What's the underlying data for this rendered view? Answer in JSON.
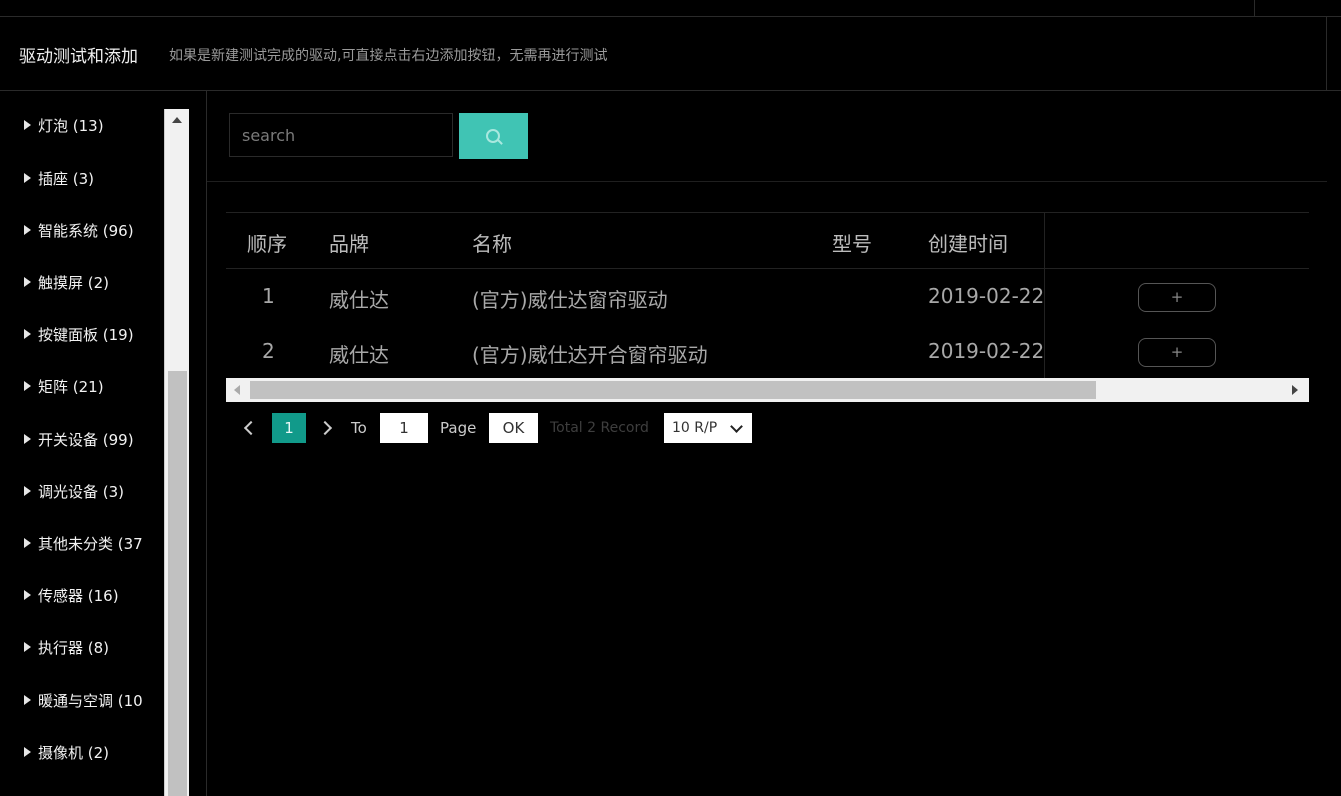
{
  "header": {
    "title": "驱动测试和添加",
    "subtitle": "如果是新建测试完成的驱动,可直接点击右边添加按钮，无需再进行测试"
  },
  "sidebar": {
    "items": [
      {
        "label": "灯泡 (13)"
      },
      {
        "label": "插座 (3)"
      },
      {
        "label": "智能系统 (96)"
      },
      {
        "label": "触摸屏 (2)"
      },
      {
        "label": "按键面板 (19)"
      },
      {
        "label": "矩阵 (21)"
      },
      {
        "label": "开关设备 (99)"
      },
      {
        "label": "调光设备 (3)"
      },
      {
        "label": "其他未分类 (37"
      },
      {
        "label": "传感器 (16)"
      },
      {
        "label": "执行器 (8)"
      },
      {
        "label": "暖通与空调 (10"
      },
      {
        "label": "摄像机 (2)"
      }
    ]
  },
  "search": {
    "placeholder": "search",
    "value": ""
  },
  "table": {
    "columns": [
      "顺序",
      "品牌",
      "名称",
      "型号",
      "创建时间"
    ],
    "rows": [
      {
        "index": "1",
        "brand": "威仕达",
        "name": "(官方)威仕达窗帘驱动",
        "model": "",
        "created": "2019-02-22",
        "action": "+"
      },
      {
        "index": "2",
        "brand": "威仕达",
        "name": "(官方)威仕达开合窗帘驱动",
        "model": "",
        "created": "2019-02-22",
        "action": "+"
      }
    ]
  },
  "pagination": {
    "current_page": "1",
    "to_label": "To",
    "goto_value": "1",
    "page_label": "Page",
    "ok_label": "OK",
    "total_text": "Total 2 Record",
    "page_size": "10 R/P"
  },
  "colors": {
    "accent": "#40c4b4",
    "page_active": "#119a8a",
    "background": "#000000"
  }
}
